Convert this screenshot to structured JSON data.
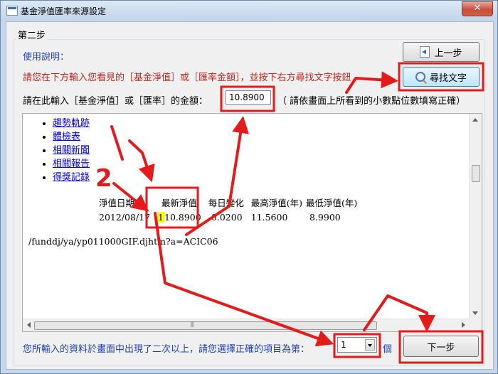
{
  "window": {
    "title": "基金淨值匯率來源設定",
    "close_label": "✕"
  },
  "step": {
    "title": "第二步"
  },
  "usage": {
    "label": "使用說明："
  },
  "instruction": "請您在下方輸入您看見的［基金淨值］或［匯率金額］，並按下右方尋找文字按鈕",
  "amount": {
    "label": "請在此輸入［基金淨值］或［匯率］的金額：",
    "value": "10.8900",
    "hint": "（ 請依畫面上所看到的小數點位數填寫正確）"
  },
  "buttons": {
    "prev": "上一步",
    "find": "尋找文字",
    "next": "下一步"
  },
  "browser": {
    "links": [
      "趨勢軌跡",
      "體檢表",
      "相關新聞",
      "相關報告",
      "得獎記錄"
    ],
    "table": {
      "headers": [
        "淨值日期",
        "最新淨值",
        "每日變化",
        "最高淨值(年)",
        "最低淨值(年)"
      ],
      "row": [
        "2012/08/17",
        "10.8900",
        "-0.0200",
        "11.5600",
        "8.9900"
      ],
      "highlight": "1"
    },
    "url": "/funddj/ya/yp011000GIF.djhtm?a=ACIC06"
  },
  "annotations": {
    "one": "1",
    "two": "2"
  },
  "bottom": {
    "text": "您所輸入的資料於畫面中出現了二次以上，請您選擇正確的項目為第：",
    "selected": "1",
    "unit": "個"
  },
  "colors": {
    "annotation": "#e31b1b",
    "instruction": "#c1261d",
    "label_blue": "#1f3fb0",
    "highlight": "#ffff00"
  }
}
